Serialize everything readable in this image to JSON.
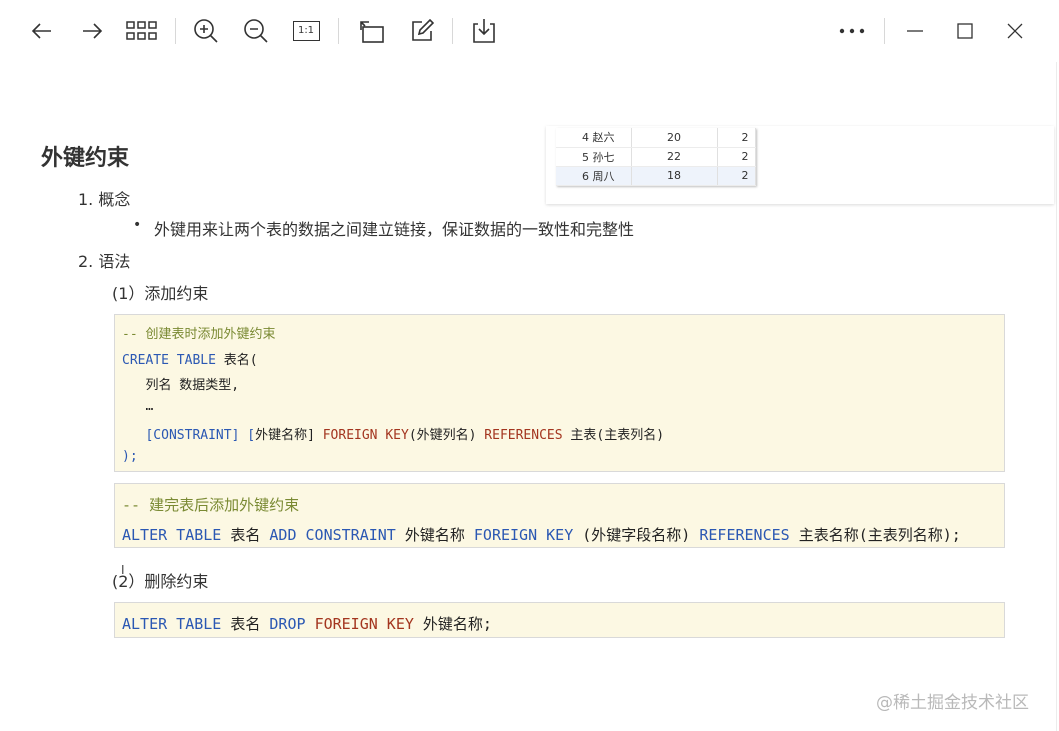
{
  "toolbar": {
    "icons": [
      "back-arrow-icon",
      "forward-arrow-icon",
      "grid-icon",
      "zoom-in-icon",
      "zoom-out-icon",
      "actual-size-icon",
      "rotate-icon",
      "edit-icon",
      "save-icon",
      "more-icon",
      "minimize-icon",
      "maximize-icon",
      "close-icon"
    ],
    "actual_size_label": "1:1"
  },
  "snippet_table": {
    "rows": [
      {
        "name": "4 赵六",
        "age": "20",
        "dept": "2"
      },
      {
        "name": "5 孙七",
        "age": "22",
        "dept": "2"
      },
      {
        "name": "6 周八",
        "age": "18",
        "dept": "2"
      }
    ]
  },
  "doc": {
    "title": "外键约束",
    "item1": "1. 概念",
    "bullet_mark": "•",
    "bullet_text": "外键用来让两个表的数据之间建立链接，保证数据的一致性和完整性",
    "item2": "2. 语法",
    "sub1": "(1）添加约束",
    "sub2": "(2）删除约束"
  },
  "code1": {
    "comment": "-- 创建表时添加外键约束",
    "l2_kw": "CREATE TABLE",
    "l2_tx": " 表名(",
    "l3": "   列名 数据类型,",
    "l4": "   …",
    "l5_kw": "   [CONSTRAINT] [",
    "l5_tx1": "外键名称] ",
    "l5_fk": "FOREIGN KEY",
    "l5_tx2": "(外键列名) ",
    "l5_ref": "REFERENCES",
    "l5_tx3": " 主表(主表列名)",
    "l6": ");"
  },
  "code2": {
    "comment": "-- 建完表后添加外键约束",
    "kw1": "ALTER TABLE",
    "tx1": " 表名 ",
    "kw2": "ADD CONSTRAINT",
    "tx2": " 外键名称 ",
    "kw3": "FOREIGN KEY",
    "tx3": " (外键字段名称) ",
    "kw4": "REFERENCES",
    "tx4": " 主表名称(主表列名称);"
  },
  "code3": {
    "kw1": "ALTER TABLE",
    "tx1": " 表名 ",
    "kw2": "DROP",
    "sp": " ",
    "fk": "FOREIGN KEY",
    "tx2": " 外键名称;"
  },
  "cursor_glyph": "I",
  "watermark": "@稀土掘金技术社区",
  "colors": {
    "keyword": "#2b58b3",
    "foreign_key": "#a3351f",
    "comment": "#7a8a33",
    "code_bg": "#fcf8e3"
  }
}
